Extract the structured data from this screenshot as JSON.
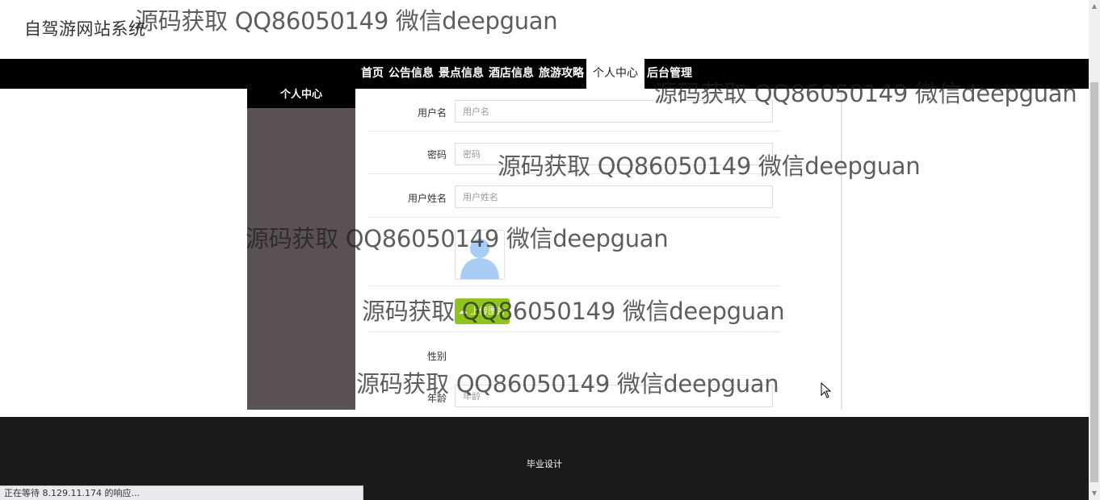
{
  "header": {
    "title": "自驾游网站系统"
  },
  "nav": {
    "items": [
      {
        "label": "首页"
      },
      {
        "label": "公告信息"
      },
      {
        "label": "景点信息"
      },
      {
        "label": "酒店信息"
      },
      {
        "label": "旅游攻略"
      },
      {
        "label": "个人中心",
        "active": true
      },
      {
        "label": "后台管理"
      }
    ]
  },
  "sidebar": {
    "title": "个人中心"
  },
  "form": {
    "username": {
      "label": "用户名",
      "placeholder": "用户名"
    },
    "password": {
      "label": "密码",
      "placeholder": "密码"
    },
    "realname": {
      "label": "用户姓名",
      "placeholder": "用户姓名"
    },
    "upload_label": "上传图片",
    "gender": {
      "label": "性别"
    },
    "age": {
      "label": "年龄",
      "placeholder": "年龄"
    }
  },
  "footer": {
    "text": "毕业设计"
  },
  "status_bar": {
    "text": "正在等待 8.129.11.174 的响应..."
  },
  "watermark": {
    "text": "源码获取 QQ86050149 微信deepguan"
  },
  "colors": {
    "nav_bg": "#000000",
    "sidebar_bg": "#5a5152",
    "footer_bg": "#1b1919",
    "upload_button": "#8fc31f",
    "avatar_icon": "#a9ccf5"
  }
}
